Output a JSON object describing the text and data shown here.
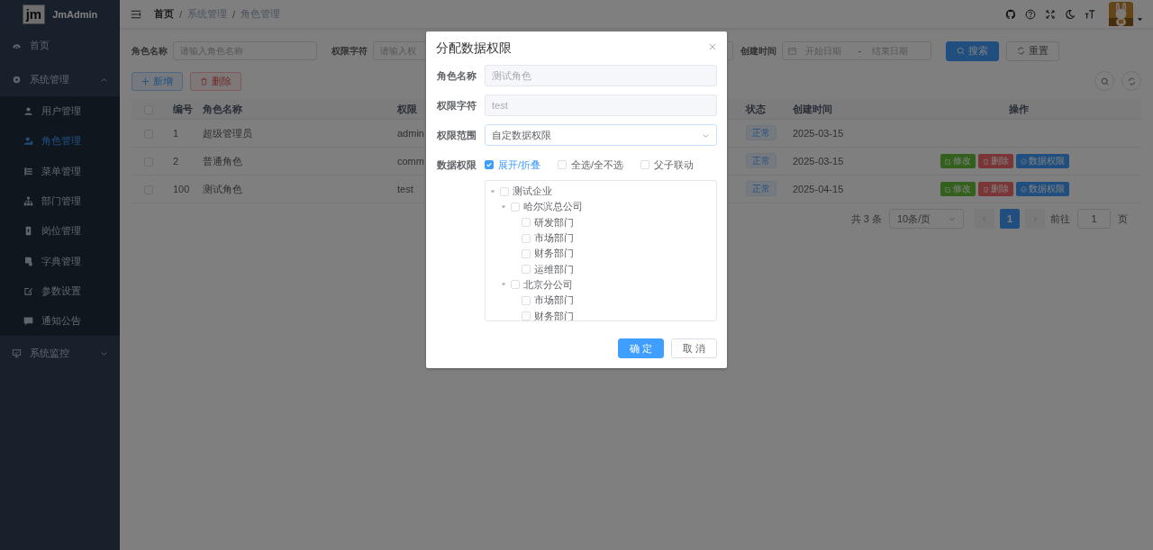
{
  "sidebar": {
    "logo": "jm",
    "title": "JmAdmin",
    "items": [
      {
        "label": "首页",
        "selected": false
      },
      {
        "label": "系统管理",
        "selected": false,
        "expanded": true,
        "children": [
          {
            "label": "用户管理",
            "selected": false
          },
          {
            "label": "角色管理",
            "selected": true
          },
          {
            "label": "菜单管理",
            "selected": false
          },
          {
            "label": "部门管理",
            "selected": false
          },
          {
            "label": "岗位管理",
            "selected": false
          },
          {
            "label": "字典管理",
            "selected": false
          },
          {
            "label": "参数设置",
            "selected": false
          },
          {
            "label": "通知公告",
            "selected": false
          }
        ]
      },
      {
        "label": "系统监控",
        "selected": false,
        "expanded": false
      }
    ]
  },
  "breadcrumb": [
    {
      "label": "首页"
    },
    {
      "sep": "/",
      "label": "系统管理"
    },
    {
      "sep": "/",
      "label": "角色管理"
    }
  ],
  "search_form": {
    "fields": [
      {
        "kind": "input",
        "label": "角色名称",
        "placeholder": "请输入角色名称"
      },
      {
        "kind": "input",
        "label": "权限字符",
        "placeholder": "请输入权"
      },
      {
        "kind": "daterange",
        "label": "创建时间",
        "start_placeholder": "开始日期",
        "separator": "-",
        "end_placeholder": "结束日期"
      }
    ],
    "buttons": [
      {
        "kind": "primary",
        "label": "搜索"
      },
      {
        "kind": "default",
        "label": "重置"
      }
    ]
  },
  "toolbar": [
    {
      "kind": "add",
      "label": "新增",
      "disabled": false
    },
    {
      "kind": "delete",
      "label": "删除",
      "disabled": true
    }
  ],
  "table": {
    "header_checked": false,
    "columns": [
      "编号",
      "角色名称",
      "权限",
      "状态",
      "创建时间",
      "操作"
    ],
    "rows": [
      {
        "checked": false,
        "id": "1",
        "name": "超级管理员",
        "key": "admin",
        "status": "正常",
        "created": "2025-03-15"
      },
      {
        "checked": false,
        "id": "2",
        "name": "普通角色",
        "key": "comm",
        "status": "正常",
        "created": "2025-03-15",
        "actions": [
          {
            "kind": "edit",
            "label": "修改"
          },
          {
            "kind": "delete",
            "label": "删除"
          },
          {
            "kind": "scope",
            "label": "数据权限"
          }
        ]
      },
      {
        "checked": false,
        "id": "100",
        "name": "测试角色",
        "key": "test",
        "status": "正常",
        "created": "2025-04-15",
        "actions": [
          {
            "kind": "edit",
            "label": "修改"
          },
          {
            "kind": "delete",
            "label": "删除"
          },
          {
            "kind": "scope",
            "label": "数据权限"
          }
        ]
      }
    ]
  },
  "pagination": {
    "total": "共 3 条",
    "page_size": "10条/页",
    "pages": [
      {
        "label": "1",
        "selected": true
      }
    ],
    "jump_label": "前往",
    "jump_value": "1",
    "jump_suffix": "页"
  },
  "dialog": {
    "title": "分配数据权限",
    "fields": [
      {
        "kind": "input",
        "label": "角色名称",
        "value": "测试角色",
        "disabled": true
      },
      {
        "kind": "input",
        "label": "权限字符",
        "value": "test",
        "disabled": true
      },
      {
        "kind": "select",
        "label": "权限范围",
        "value": "自定数据权限",
        "disabled": false
      }
    ],
    "data_scope": {
      "label": "数据权限",
      "options": [
        {
          "label": "展开/折叠",
          "checked": true
        },
        {
          "label": "全选/全不选",
          "checked": false
        },
        {
          "label": "父子联动",
          "checked": false
        }
      ],
      "tree": [
        {
          "label": "测试企业",
          "checked": false,
          "expanded": true,
          "children": [
            {
              "label": "哈尔滨总公司",
              "checked": false,
              "expanded": true,
              "children": [
                {
                  "label": "研发部门",
                  "checked": false
                },
                {
                  "label": "市场部门",
                  "checked": false
                },
                {
                  "label": "财务部门",
                  "checked": false
                },
                {
                  "label": "运维部门",
                  "checked": false
                }
              ]
            },
            {
              "label": "北京分公司",
              "checked": false,
              "expanded": true,
              "children": [
                {
                  "label": "市场部门",
                  "checked": false
                },
                {
                  "label": "财务部门",
                  "checked": false
                }
              ]
            }
          ]
        }
      ]
    },
    "buttons": [
      {
        "kind": "primary",
        "label": "确 定"
      },
      {
        "kind": "default",
        "label": "取 消"
      }
    ]
  }
}
